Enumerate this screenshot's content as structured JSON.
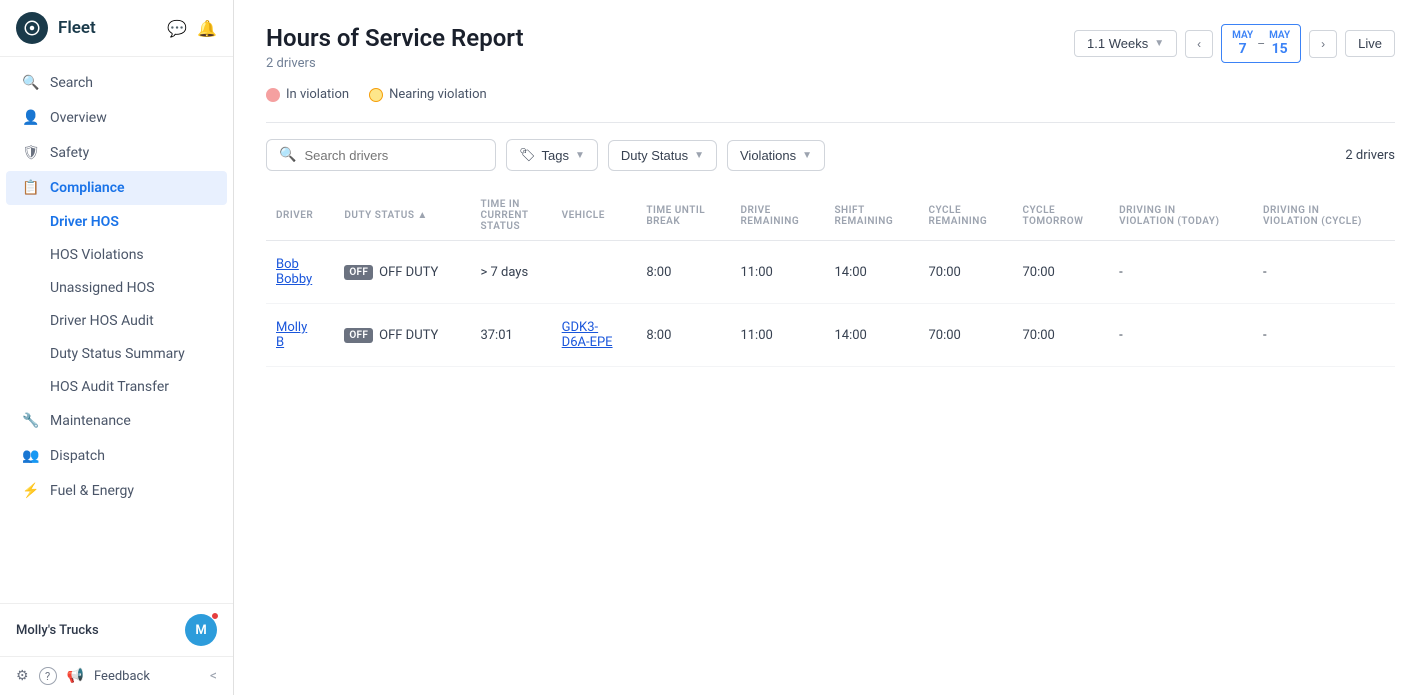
{
  "sidebar": {
    "title": "Fleet",
    "nav_items": [
      {
        "id": "search",
        "label": "Search",
        "icon": "🔍"
      },
      {
        "id": "overview",
        "label": "Overview",
        "icon": "👤"
      },
      {
        "id": "safety",
        "label": "Safety",
        "icon": "🛡"
      },
      {
        "id": "compliance",
        "label": "Compliance",
        "icon": "📋"
      }
    ],
    "sub_items": [
      {
        "id": "driver-hos",
        "label": "Driver HOS",
        "active": true
      },
      {
        "id": "hos-violations",
        "label": "HOS Violations"
      },
      {
        "id": "unassigned-hos",
        "label": "Unassigned HOS"
      },
      {
        "id": "driver-hos-audit",
        "label": "Driver HOS Audit"
      },
      {
        "id": "duty-status-summary",
        "label": "Duty Status Summary"
      },
      {
        "id": "hos-audit-transfer",
        "label": "HOS Audit Transfer"
      }
    ],
    "bottom_items": [
      {
        "id": "maintenance",
        "label": "Maintenance",
        "icon": "🔧"
      },
      {
        "id": "dispatch",
        "label": "Dispatch",
        "icon": "👥"
      },
      {
        "id": "fuel-energy",
        "label": "Fuel & Energy",
        "icon": "⚡"
      }
    ],
    "user": {
      "name": "Molly's Trucks",
      "avatar_letter": "M"
    },
    "footer_items": [
      {
        "id": "settings",
        "label": "⚙"
      },
      {
        "id": "help",
        "label": "?"
      },
      {
        "id": "feedback",
        "label": "Feedback"
      },
      {
        "id": "collapse",
        "label": "<"
      }
    ]
  },
  "page": {
    "title": "Hours of Service Report",
    "subtitle": "2 drivers",
    "week_selector": "1.1 Weeks",
    "date_from_month": "MAY",
    "date_from_day": "7",
    "date_to_month": "MAY",
    "date_to_day": "15",
    "live_label": "Live",
    "drivers_count": "2 drivers"
  },
  "legend": {
    "in_violation": "In violation",
    "nearing_violation": "Nearing violation"
  },
  "filters": {
    "search_placeholder": "Search drivers",
    "tags_label": "Tags",
    "duty_status_label": "Duty Status",
    "violations_label": "Violations"
  },
  "table": {
    "columns": [
      {
        "id": "driver",
        "label": "DRIVER"
      },
      {
        "id": "duty-status",
        "label": "DUTY STATUS ▲"
      },
      {
        "id": "time-in-status",
        "label": "TIME IN CURRENT STATUS"
      },
      {
        "id": "vehicle",
        "label": "VEHICLE"
      },
      {
        "id": "time-until-break",
        "label": "TIME UNTIL BREAK"
      },
      {
        "id": "drive-remaining",
        "label": "DRIVE REMAINING"
      },
      {
        "id": "shift-remaining",
        "label": "SHIFT REMAINING"
      },
      {
        "id": "cycle-remaining",
        "label": "CYCLE REMAINING"
      },
      {
        "id": "cycle-tomorrow",
        "label": "CYCLE TOMORROW"
      },
      {
        "id": "driving-violation-today",
        "label": "DRIVING IN VIOLATION (TODAY)"
      },
      {
        "id": "driving-violation-cycle",
        "label": "DRIVING IN VIOLATION (CYCLE)"
      }
    ],
    "rows": [
      {
        "driver": "Bob Bobby",
        "duty_status": "OFF DUTY",
        "time_in_status": "> 7 days",
        "vehicle": "",
        "time_until_break": "8:00",
        "drive_remaining": "11:00",
        "shift_remaining": "14:00",
        "cycle_remaining": "70:00",
        "cycle_tomorrow": "70:00",
        "driving_violation_today": "-",
        "driving_violation_cycle": "-"
      },
      {
        "driver": "Molly B",
        "duty_status": "OFF DUTY",
        "time_in_status": "37:01",
        "vehicle": "GDK3-D6A-EPE",
        "time_until_break": "8:00",
        "drive_remaining": "11:00",
        "shift_remaining": "14:00",
        "cycle_remaining": "70:00",
        "cycle_tomorrow": "70:00",
        "driving_violation_today": "-",
        "driving_violation_cycle": "-"
      }
    ]
  }
}
